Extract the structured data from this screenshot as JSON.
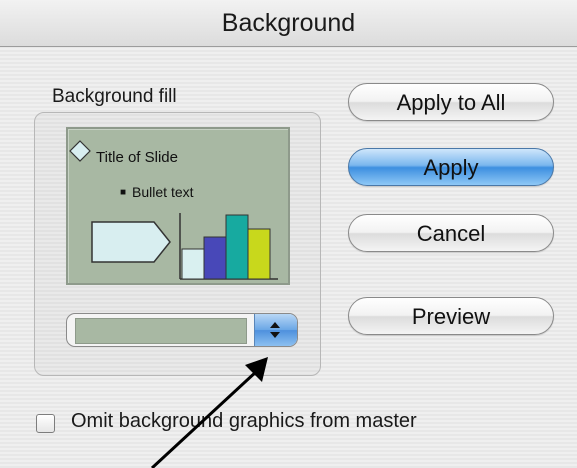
{
  "dialog": {
    "title": "Background"
  },
  "fill_group": {
    "label": "Background fill",
    "preview": {
      "slide_title": "Title of Slide",
      "bullet_text": "Bullet text",
      "bullet_glyph": "■",
      "colors": {
        "background": "#a8b8a3",
        "shape": "#d8eef0",
        "bars": [
          "#d9f0f0",
          "#4848b8",
          "#17aaa0",
          "#c8d81c"
        ]
      }
    },
    "color_popup": {
      "selected_color": "#a8b8a3"
    }
  },
  "buttons": {
    "apply_to_all": "Apply to All",
    "apply": "Apply",
    "cancel": "Cancel",
    "preview": "Preview"
  },
  "omit_checkbox": {
    "label": "Omit background graphics from master",
    "checked": false
  }
}
